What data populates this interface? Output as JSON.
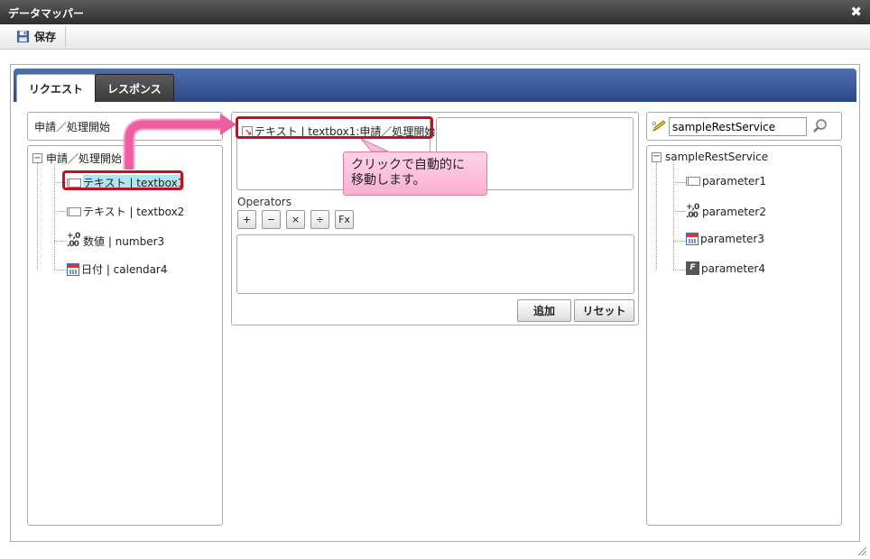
{
  "window": {
    "title": "データマッパー"
  },
  "toolbar": {
    "save_label": "保存"
  },
  "tabs": [
    {
      "label": "リクエスト",
      "active": true
    },
    {
      "label": "レスポンス",
      "active": false
    }
  ],
  "left": {
    "header": "申請／処理開始",
    "tree": {
      "root": "申請／処理開始",
      "items": [
        {
          "icon": "text-field-icon",
          "label": "テキスト | textbox1",
          "selected": true
        },
        {
          "icon": "text-field-icon",
          "label": "テキスト | textbox2",
          "selected": false
        },
        {
          "icon": "number-icon",
          "icon_text": "+,0\n.00",
          "label": "数値 | number3",
          "selected": false
        },
        {
          "icon": "calendar-icon",
          "label": "日付 | calendar4",
          "selected": false
        }
      ]
    }
  },
  "middle": {
    "mapped_entry": "テキスト | textbox1:申請／処理開始",
    "operators_label": "Operators",
    "operators": [
      "+",
      "−",
      "×",
      "÷",
      "Fx"
    ],
    "add_button": "追加",
    "reset_button": "リセット"
  },
  "right": {
    "search_value": "sampleRestService",
    "tree": {
      "root": "sampleRestService",
      "items": [
        {
          "icon": "text-field-icon",
          "label": "parameter1"
        },
        {
          "icon": "number-icon",
          "label": "parameter2"
        },
        {
          "icon": "calendar-icon",
          "label": "parameter3"
        },
        {
          "icon": "binary-icon",
          "icon_text": "F",
          "label": "parameter4"
        }
      ]
    }
  },
  "annotation": {
    "tooltip_text": "クリックで自動的に移動します。",
    "highlight_color": "#c4101f",
    "arrow_color": "#f06aa5"
  },
  "colors": {
    "tabbar": "#2d4787",
    "selected_row": "#aee6f2"
  }
}
